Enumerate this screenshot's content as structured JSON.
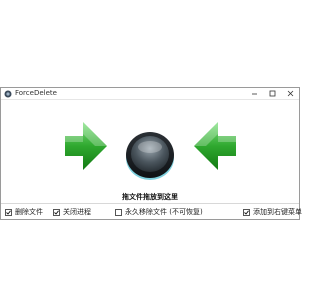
{
  "window": {
    "title": "ForceDelete",
    "icon": "app-disc-icon"
  },
  "title_controls": {
    "minimize_icon": "minimize-icon",
    "maximize_icon": "maximize-icon",
    "close_icon": "close-icon"
  },
  "main": {
    "hint": "拖文件拖放到这里",
    "left_arrow_icon": "green-arrow-right-icon",
    "right_arrow_icon": "green-arrow-left-icon",
    "target_icon": "drop-target-disc-icon"
  },
  "options": [
    {
      "label": "删除文件",
      "checked": true
    },
    {
      "label": "关闭进程",
      "checked": true
    },
    {
      "label": "永久移除文件 (不可恢复)",
      "checked": false
    },
    {
      "label": "添加到右键菜单",
      "checked": true
    }
  ],
  "colors": {
    "arrow_green": "#2fa82f",
    "window_border": "#9a9a9a"
  }
}
